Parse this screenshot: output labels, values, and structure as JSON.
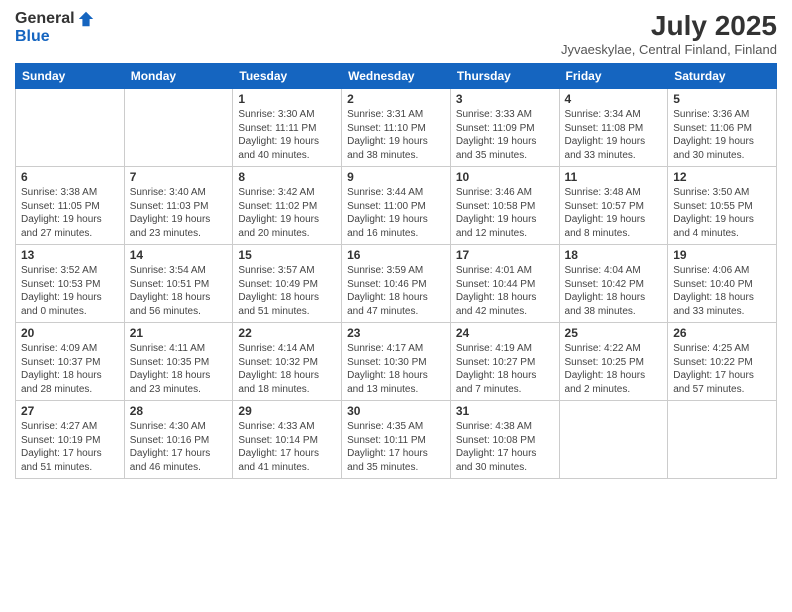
{
  "logo": {
    "general": "General",
    "blue": "Blue"
  },
  "header": {
    "month": "July 2025",
    "location": "Jyvaeskylae, Central Finland, Finland"
  },
  "weekdays": [
    "Sunday",
    "Monday",
    "Tuesday",
    "Wednesday",
    "Thursday",
    "Friday",
    "Saturday"
  ],
  "weeks": [
    [
      {
        "day": "",
        "info": ""
      },
      {
        "day": "",
        "info": ""
      },
      {
        "day": "1",
        "info": "Sunrise: 3:30 AM\nSunset: 11:11 PM\nDaylight: 19 hours\nand 40 minutes."
      },
      {
        "day": "2",
        "info": "Sunrise: 3:31 AM\nSunset: 11:10 PM\nDaylight: 19 hours\nand 38 minutes."
      },
      {
        "day": "3",
        "info": "Sunrise: 3:33 AM\nSunset: 11:09 PM\nDaylight: 19 hours\nand 35 minutes."
      },
      {
        "day": "4",
        "info": "Sunrise: 3:34 AM\nSunset: 11:08 PM\nDaylight: 19 hours\nand 33 minutes."
      },
      {
        "day": "5",
        "info": "Sunrise: 3:36 AM\nSunset: 11:06 PM\nDaylight: 19 hours\nand 30 minutes."
      }
    ],
    [
      {
        "day": "6",
        "info": "Sunrise: 3:38 AM\nSunset: 11:05 PM\nDaylight: 19 hours\nand 27 minutes."
      },
      {
        "day": "7",
        "info": "Sunrise: 3:40 AM\nSunset: 11:03 PM\nDaylight: 19 hours\nand 23 minutes."
      },
      {
        "day": "8",
        "info": "Sunrise: 3:42 AM\nSunset: 11:02 PM\nDaylight: 19 hours\nand 20 minutes."
      },
      {
        "day": "9",
        "info": "Sunrise: 3:44 AM\nSunset: 11:00 PM\nDaylight: 19 hours\nand 16 minutes."
      },
      {
        "day": "10",
        "info": "Sunrise: 3:46 AM\nSunset: 10:58 PM\nDaylight: 19 hours\nand 12 minutes."
      },
      {
        "day": "11",
        "info": "Sunrise: 3:48 AM\nSunset: 10:57 PM\nDaylight: 19 hours\nand 8 minutes."
      },
      {
        "day": "12",
        "info": "Sunrise: 3:50 AM\nSunset: 10:55 PM\nDaylight: 19 hours\nand 4 minutes."
      }
    ],
    [
      {
        "day": "13",
        "info": "Sunrise: 3:52 AM\nSunset: 10:53 PM\nDaylight: 19 hours\nand 0 minutes."
      },
      {
        "day": "14",
        "info": "Sunrise: 3:54 AM\nSunset: 10:51 PM\nDaylight: 18 hours\nand 56 minutes."
      },
      {
        "day": "15",
        "info": "Sunrise: 3:57 AM\nSunset: 10:49 PM\nDaylight: 18 hours\nand 51 minutes."
      },
      {
        "day": "16",
        "info": "Sunrise: 3:59 AM\nSunset: 10:46 PM\nDaylight: 18 hours\nand 47 minutes."
      },
      {
        "day": "17",
        "info": "Sunrise: 4:01 AM\nSunset: 10:44 PM\nDaylight: 18 hours\nand 42 minutes."
      },
      {
        "day": "18",
        "info": "Sunrise: 4:04 AM\nSunset: 10:42 PM\nDaylight: 18 hours\nand 38 minutes."
      },
      {
        "day": "19",
        "info": "Sunrise: 4:06 AM\nSunset: 10:40 PM\nDaylight: 18 hours\nand 33 minutes."
      }
    ],
    [
      {
        "day": "20",
        "info": "Sunrise: 4:09 AM\nSunset: 10:37 PM\nDaylight: 18 hours\nand 28 minutes."
      },
      {
        "day": "21",
        "info": "Sunrise: 4:11 AM\nSunset: 10:35 PM\nDaylight: 18 hours\nand 23 minutes."
      },
      {
        "day": "22",
        "info": "Sunrise: 4:14 AM\nSunset: 10:32 PM\nDaylight: 18 hours\nand 18 minutes."
      },
      {
        "day": "23",
        "info": "Sunrise: 4:17 AM\nSunset: 10:30 PM\nDaylight: 18 hours\nand 13 minutes."
      },
      {
        "day": "24",
        "info": "Sunrise: 4:19 AM\nSunset: 10:27 PM\nDaylight: 18 hours\nand 7 minutes."
      },
      {
        "day": "25",
        "info": "Sunrise: 4:22 AM\nSunset: 10:25 PM\nDaylight: 18 hours\nand 2 minutes."
      },
      {
        "day": "26",
        "info": "Sunrise: 4:25 AM\nSunset: 10:22 PM\nDaylight: 17 hours\nand 57 minutes."
      }
    ],
    [
      {
        "day": "27",
        "info": "Sunrise: 4:27 AM\nSunset: 10:19 PM\nDaylight: 17 hours\nand 51 minutes."
      },
      {
        "day": "28",
        "info": "Sunrise: 4:30 AM\nSunset: 10:16 PM\nDaylight: 17 hours\nand 46 minutes."
      },
      {
        "day": "29",
        "info": "Sunrise: 4:33 AM\nSunset: 10:14 PM\nDaylight: 17 hours\nand 41 minutes."
      },
      {
        "day": "30",
        "info": "Sunrise: 4:35 AM\nSunset: 10:11 PM\nDaylight: 17 hours\nand 35 minutes."
      },
      {
        "day": "31",
        "info": "Sunrise: 4:38 AM\nSunset: 10:08 PM\nDaylight: 17 hours\nand 30 minutes."
      },
      {
        "day": "",
        "info": ""
      },
      {
        "day": "",
        "info": ""
      }
    ]
  ]
}
